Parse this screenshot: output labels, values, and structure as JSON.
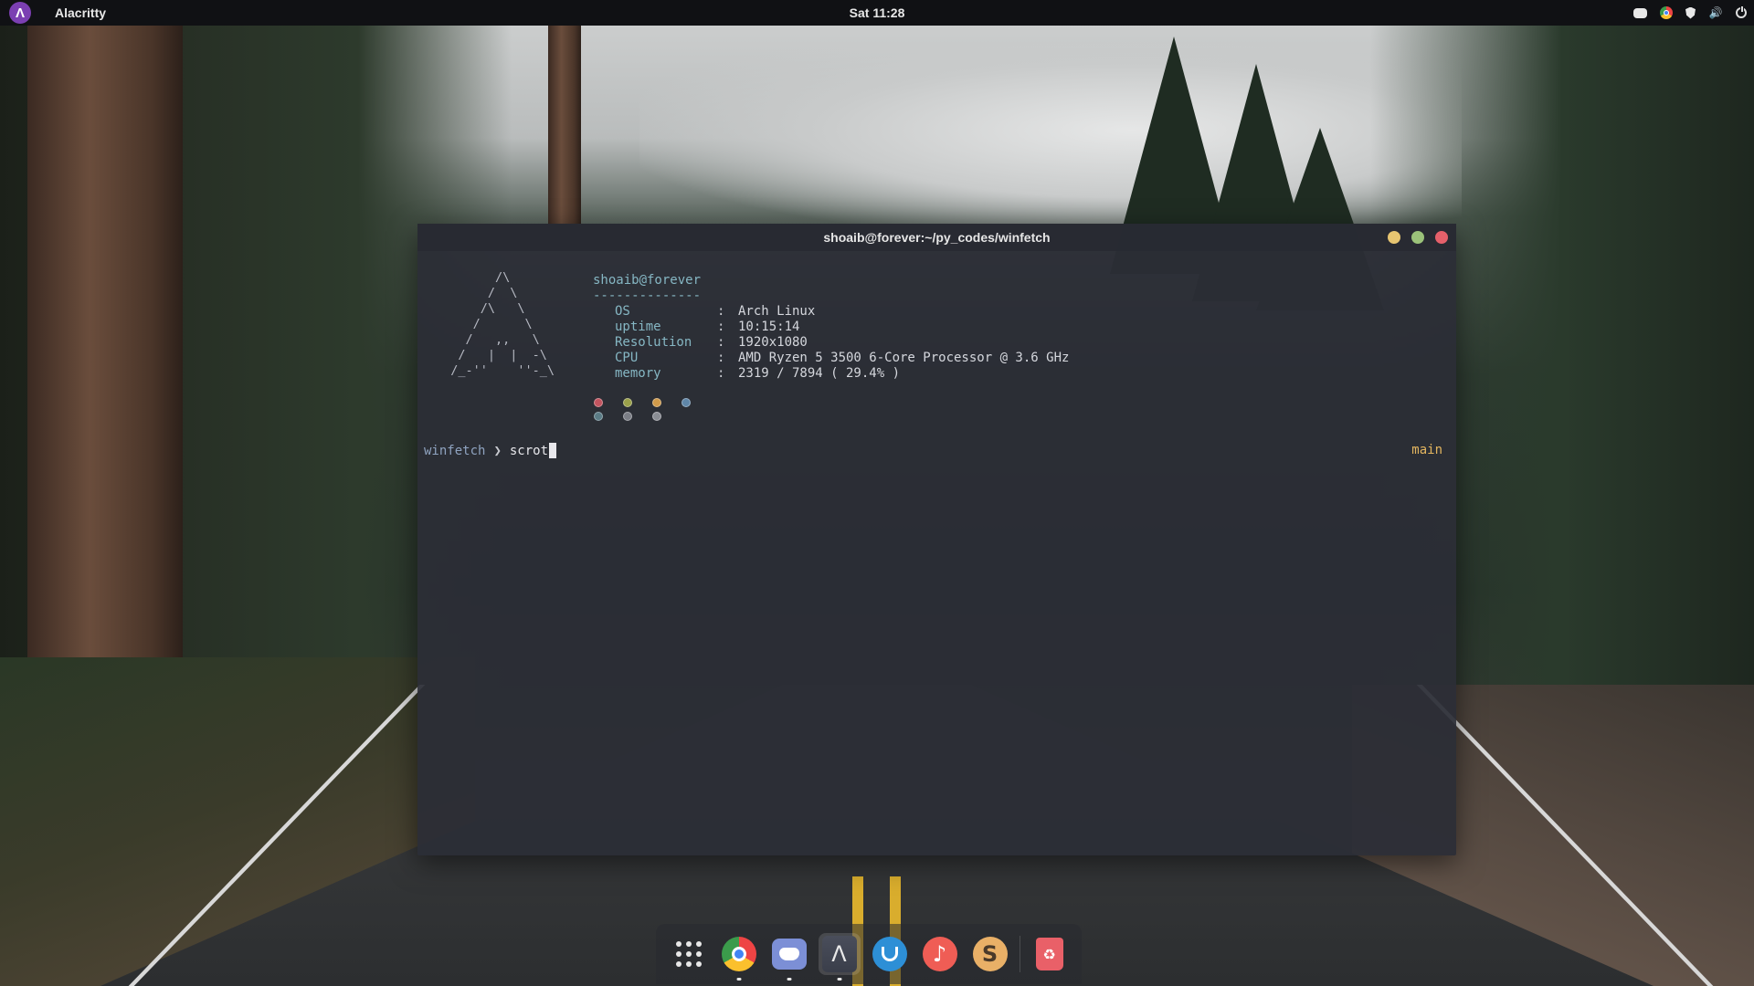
{
  "topbar": {
    "app_name": "Alacritty",
    "clock": "Sat 11:28",
    "tray_icons": [
      "discord-icon",
      "chrome-icon",
      "shield-icon",
      "volume-icon",
      "power-icon"
    ]
  },
  "terminal": {
    "title": "shoaib@forever:~/py_codes/winfetch",
    "ascii_logo": "        /\\\n       /  \\\n      /\\   \\\n     /      \\\n    /   ,,   \\\n   /   |  |  -\\\n  /_-''    ''-_\\",
    "user_host": "shoaib@forever",
    "separator": "--------------",
    "info_rows": [
      {
        "glyph": "",
        "key": "OS",
        "colon": ":",
        "value": "Arch Linux"
      },
      {
        "glyph": "",
        "key": "uptime",
        "colon": ":",
        "value": "10:15:14"
      },
      {
        "glyph": "",
        "key": "Resolution",
        "colon": ":",
        "value": "1920x1080"
      },
      {
        "glyph": "",
        "key": "CPU",
        "colon": ":",
        "value": "AMD Ryzen 5 3500 6-Core Processor @ 3.6 GHz"
      },
      {
        "glyph": "",
        "key": "memory",
        "colon": ":",
        "value": "2319 / 7894 ( 29.4% )"
      }
    ],
    "palette": [
      "#c2545f",
      "#9aa04a",
      "#d09a4a",
      "#5f86a8",
      "#5b7c86",
      "#7b7e86",
      "#8a8d94"
    ],
    "prompt_dir": "winfetch",
    "prompt_symbol": "❯",
    "command": "scrot",
    "git_branch": "main"
  },
  "dock": {
    "items": [
      "apps-grid-icon",
      "chrome-icon",
      "discord-icon",
      "alacritty-icon",
      "software-store-icon",
      "music-icon",
      "sublime-text-icon",
      "trash-icon"
    ],
    "alacritty_glyph": "Λ",
    "music_glyph": "♪",
    "sublime_glyph": "S",
    "trash_glyph": "♻"
  },
  "colors": {
    "accent_arch": "#7b3fb2",
    "terminal_bg": "#2b2d36",
    "prompt_dir": "#8fa3c0",
    "branch": "#e3b55f",
    "info_key": "#86b7c4"
  }
}
